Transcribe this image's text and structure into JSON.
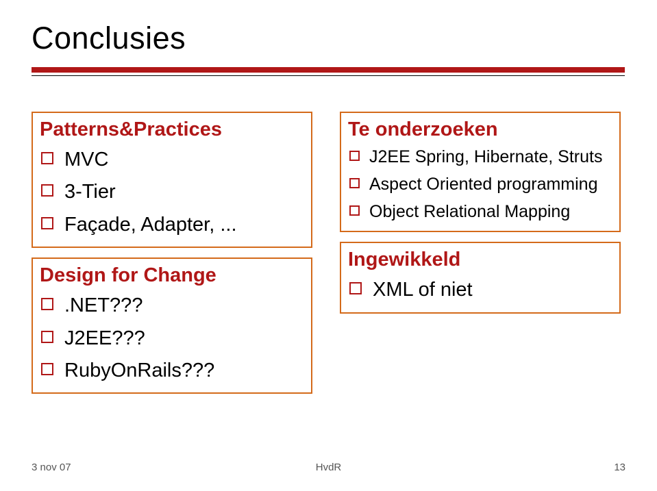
{
  "title": "Conclusies",
  "columns": [
    {
      "groups": [
        {
          "heading": "Patterns&Practices",
          "sub": false,
          "items": [
            "MVC",
            "3-Tier",
            "Façade, Adapter, ..."
          ]
        },
        {
          "heading": "Design for Change",
          "sub": false,
          "items": [
            ".NET???",
            "J2EE???",
            "RubyOnRails???"
          ]
        }
      ]
    },
    {
      "groups": [
        {
          "heading": "Te onderzoeken",
          "sub": true,
          "items": [
            "J2EE Spring, Hibernate, Struts",
            "Aspect Oriented programming",
            "Object Relational Mapping"
          ]
        },
        {
          "heading": "Ingewikkeld",
          "sub": false,
          "items": [
            "XML of niet"
          ]
        }
      ]
    }
  ],
  "footer": {
    "date": "3 nov 07",
    "author": "HvdR",
    "page": "13"
  }
}
